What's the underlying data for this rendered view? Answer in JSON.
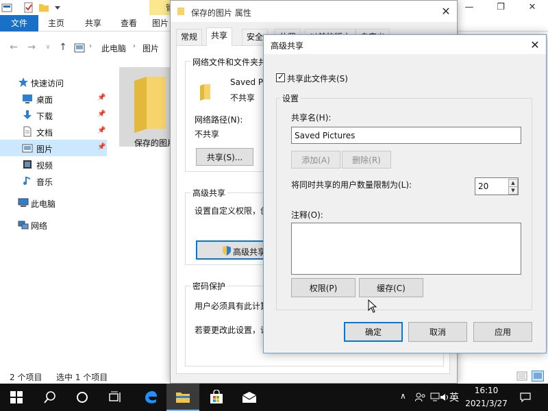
{
  "explorer": {
    "ribbon_context_label": "管",
    "tabs": [
      "文件",
      "主页",
      "共享",
      "查看",
      "图片"
    ],
    "breadcrumb": [
      "此电脑",
      "图片"
    ],
    "nav_items": [
      {
        "label": "快速访问",
        "icon": "star-icon"
      },
      {
        "label": "桌面",
        "icon": "desktop-icon"
      },
      {
        "label": "下载",
        "icon": "download-icon"
      },
      {
        "label": "文档",
        "icon": "document-icon"
      },
      {
        "label": "图片",
        "icon": "pictures-icon"
      },
      {
        "label": "视频",
        "icon": "video-icon"
      },
      {
        "label": "音乐",
        "icon": "music-icon"
      },
      {
        "label": "此电脑",
        "icon": "computer-icon"
      },
      {
        "label": "网络",
        "icon": "network-icon"
      }
    ],
    "folder_label": "保存的图片",
    "status_items": "2 个项目",
    "status_selected": "选中 1 个项目"
  },
  "props": {
    "title": "保存的图片 属性",
    "tabs": [
      "常规",
      "共享",
      "安全",
      "位置",
      "以前的版本",
      "自定义"
    ],
    "net_group_title": "网络文件和文件夹共享",
    "folder_name": "Saved Pictures",
    "share_state": "不共享",
    "net_path_label": "网络路径(N):",
    "net_path_value": "不共享",
    "share_button": "共享(S)...",
    "adv_group_title": "高级共享",
    "adv_desc": "设置自定义权限，创建多个共享",
    "adv_button": "高级共享(D)...",
    "pwd_group_title": "密码保护",
    "pwd_line1": "用户必须具有此计算机的用户帐户",
    "pwd_line2": "若要更改此设置，请使用网络和共享中心"
  },
  "adv": {
    "title": "高级共享",
    "share_checkbox": "共享此文件夹(S)",
    "settings_label": "设置",
    "share_name_label": "共享名(H):",
    "share_name_value": "Saved Pictures",
    "add_button": "添加(A)",
    "remove_button": "删除(R)",
    "limit_label": "将同时共享的用户数量限制为(L):",
    "limit_value": "20",
    "comment_label": "注释(O):",
    "permissions_button": "权限(P)",
    "caching_button": "缓存(C)",
    "ok_button": "确定",
    "cancel_button": "取消",
    "apply_button": "应用"
  },
  "taskbar": {
    "ime": "英",
    "time": "16:10",
    "date": "2021/3/27"
  },
  "colors": {
    "accent": "#0078d7",
    "file_tab": "#1a6fc6",
    "folder": "#f4c542",
    "selection": "#cce8ff"
  }
}
